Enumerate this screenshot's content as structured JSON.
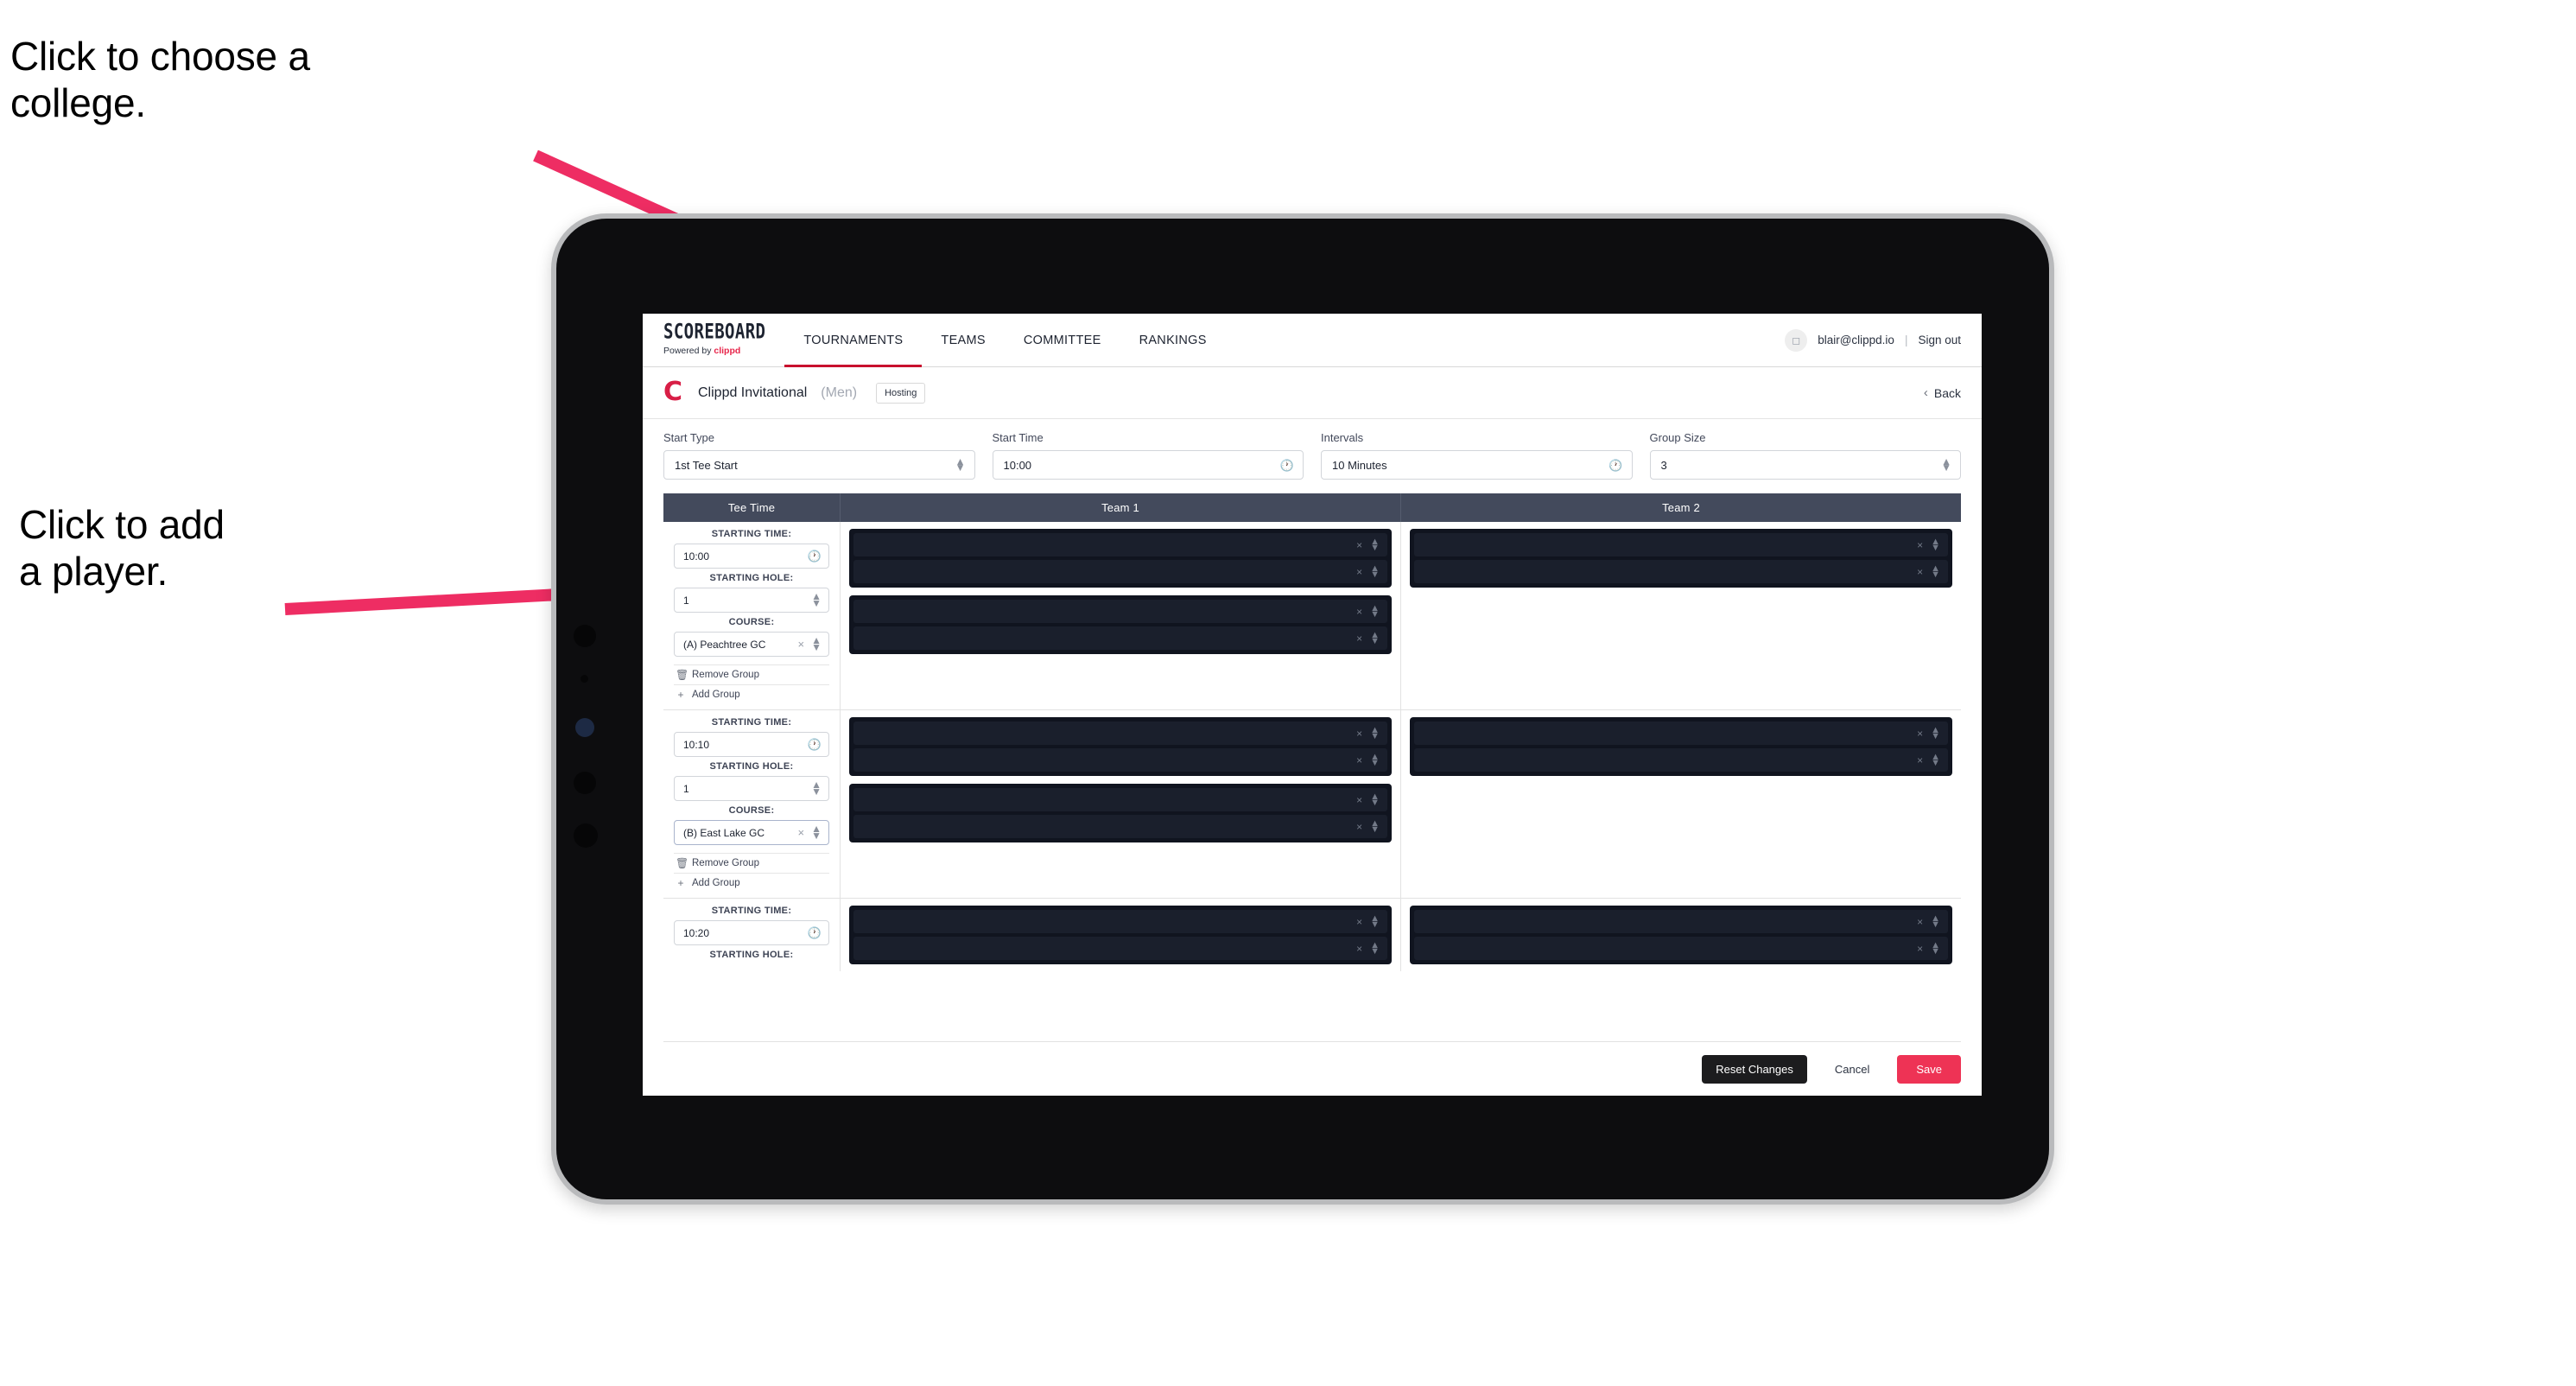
{
  "annotations": [
    {
      "id": "choose-college",
      "text": "Click to choose a\ncollege."
    },
    {
      "id": "add-player",
      "text": "Click to add\na player."
    }
  ],
  "colors": {
    "accent_pink": "#ee3355",
    "arrow_pink": "#ee2d63",
    "nav_active_underline": "#c8102e",
    "table_header_bg": "#434a5c",
    "slot_bg": "#1a1f2c"
  },
  "navbar": {
    "brand_top": "SCOREBOARD",
    "brand_sub_prefix": "Powered by ",
    "brand_sub_name": "clippd",
    "links": [
      {
        "label": "TOURNAMENTS",
        "active": true
      },
      {
        "label": "TEAMS",
        "active": false
      },
      {
        "label": "COMMITTEE",
        "active": false
      },
      {
        "label": "RANKINGS",
        "active": false
      }
    ],
    "avatar_icon": "user-avatar-icon",
    "user_email": "blair@clippd.io",
    "separator": "|",
    "sign_out": "Sign out"
  },
  "tournament_bar": {
    "logo_glyph": "C",
    "name": "Clippd Invitational",
    "gender": "(Men)",
    "badge": "Hosting",
    "back_label": "Back",
    "back_icon": "chevron-left-icon"
  },
  "controls": [
    {
      "label": "Start Type",
      "value": "1st Tee Start",
      "icon": "stepper-icon"
    },
    {
      "label": "Start Time",
      "value": "10:00",
      "icon": "clock-icon"
    },
    {
      "label": "Intervals",
      "value": "10 Minutes",
      "icon": "clock-icon"
    },
    {
      "label": "Group Size",
      "value": "3",
      "icon": "stepper-icon"
    }
  ],
  "table": {
    "headers": {
      "tee_time": "Tee Time",
      "team1": "Team 1",
      "team2": "Team 2"
    },
    "field_labels": {
      "starting_time": "STARTING TIME:",
      "starting_hole": "STARTING HOLE:",
      "course": "COURSE:"
    },
    "actions": {
      "remove_group": "Remove Group",
      "remove_icon": "trash-icon",
      "add_group": "Add Group",
      "add_icon": "plus-icon"
    },
    "slot_icons": {
      "clear": "close-icon",
      "reorder": "stepper-icon"
    },
    "groups": [
      {
        "starting_time": "10:00",
        "starting_hole": "1",
        "course": "(A) Peachtree GC",
        "course_focused": false,
        "team1": [
          {
            "players": [
              "",
              ""
            ]
          },
          {
            "players": [
              "",
              ""
            ]
          }
        ],
        "team2": [
          {
            "players": [
              "",
              ""
            ]
          }
        ]
      },
      {
        "starting_time": "10:10",
        "starting_hole": "1",
        "course": "(B) East Lake GC",
        "course_focused": true,
        "team1": [
          {
            "players": [
              "",
              ""
            ]
          },
          {
            "players": [
              "",
              ""
            ]
          }
        ],
        "team2": [
          {
            "players": [
              "",
              ""
            ]
          }
        ]
      },
      {
        "starting_time": "10:20",
        "starting_hole": "",
        "course": "",
        "course_focused": false,
        "team1": [
          {
            "players": [
              "",
              ""
            ]
          }
        ],
        "team2": [
          {
            "players": [
              "",
              ""
            ]
          }
        ]
      }
    ]
  },
  "footer": {
    "reset": "Reset Changes",
    "cancel": "Cancel",
    "save": "Save"
  }
}
